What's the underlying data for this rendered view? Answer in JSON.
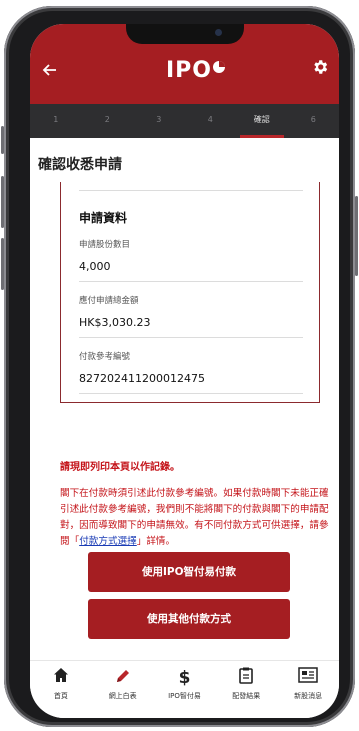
{
  "header": {
    "back_icon": "back-arrow-icon",
    "logo_text": "IPO",
    "settings_icon": "gear-icon"
  },
  "steps": [
    {
      "label": "1"
    },
    {
      "label": "2"
    },
    {
      "label": "3"
    },
    {
      "label": "4"
    },
    {
      "label": "確認"
    },
    {
      "label": "6"
    }
  ],
  "page_title": "確認收悉申請",
  "card": {
    "title": "申請資料",
    "fields": [
      {
        "label": "申請股份數目",
        "value": "4,000"
      },
      {
        "label": "應付申請總金額",
        "value": "HK$3,030.23"
      },
      {
        "label": "付款參考編號",
        "value": "827202411200012475"
      }
    ]
  },
  "notice": "請現即列印本頁以作記錄。",
  "paragraph": {
    "text_before": "閣下在付款時須引述此付款參考編號。如果付款時閣下未能正確引述此付款參考編號，我們則不能將閣下的付款與閣下的申請配對，因而導致閣下的申請無效。有不同付款方式可供選擇，請參閱「",
    "link": "付款方式選擇",
    "text_after": "」詳情。"
  },
  "buttons": {
    "primary": "使用IPO智付易付款",
    "secondary": "使用其他付款方式"
  },
  "bottom_nav": [
    {
      "label": "首頁",
      "icon": "home-icon"
    },
    {
      "label": "網上白表",
      "icon": "pen-icon"
    },
    {
      "label": "IPO智付易",
      "icon": "dollar-icon"
    },
    {
      "label": "配發結果",
      "icon": "clipboard-icon"
    },
    {
      "label": "新股消息",
      "icon": "newspaper-icon"
    }
  ],
  "colors": {
    "brand_red": "#a51e22",
    "steps_bg": "#2e2e30",
    "notice_red": "#c4141a",
    "link_blue": "#1a3bb5"
  }
}
